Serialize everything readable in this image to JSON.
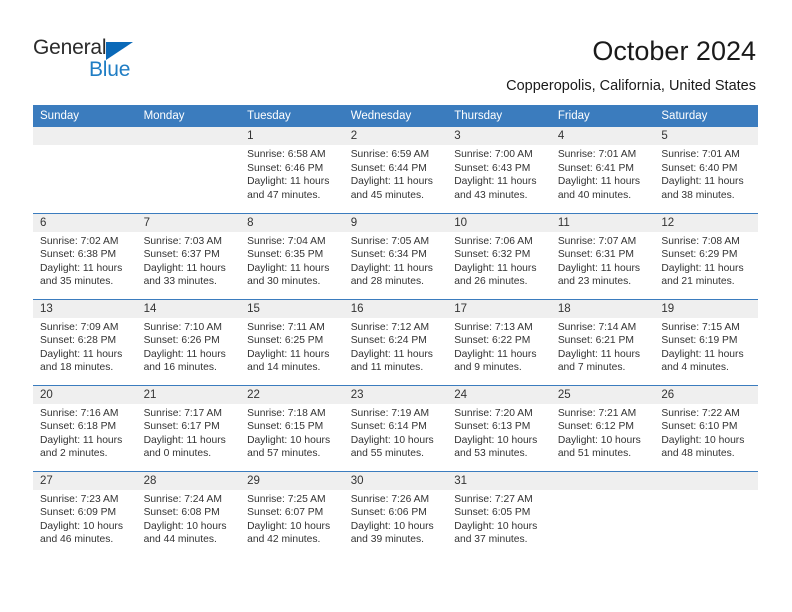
{
  "brand": {
    "name_top": "General",
    "name_bottom": "Blue",
    "triangle_color": "#0a69b8",
    "blue_text_color": "#1f7dc4"
  },
  "header": {
    "title": "October 2024",
    "location": "Copperopolis, California, United States",
    "header_bg": "#3b7cbe",
    "daynum_bg": "#efefef"
  },
  "weekday_headers": [
    "Sunday",
    "Monday",
    "Tuesday",
    "Wednesday",
    "Thursday",
    "Friday",
    "Saturday"
  ],
  "labels": {
    "sunrise": "Sunrise:",
    "sunset": "Sunset:",
    "daylight": "Daylight:"
  },
  "weeks": [
    [
      {
        "day": "",
        "sunrise": "",
        "sunset": "",
        "daylight_line1": "",
        "daylight_line2": ""
      },
      {
        "day": "",
        "sunrise": "",
        "sunset": "",
        "daylight_line1": "",
        "daylight_line2": ""
      },
      {
        "day": "1",
        "sunrise": "Sunrise: 6:58 AM",
        "sunset": "Sunset: 6:46 PM",
        "daylight_line1": "Daylight: 11 hours",
        "daylight_line2": "and 47 minutes."
      },
      {
        "day": "2",
        "sunrise": "Sunrise: 6:59 AM",
        "sunset": "Sunset: 6:44 PM",
        "daylight_line1": "Daylight: 11 hours",
        "daylight_line2": "and 45 minutes."
      },
      {
        "day": "3",
        "sunrise": "Sunrise: 7:00 AM",
        "sunset": "Sunset: 6:43 PM",
        "daylight_line1": "Daylight: 11 hours",
        "daylight_line2": "and 43 minutes."
      },
      {
        "day": "4",
        "sunrise": "Sunrise: 7:01 AM",
        "sunset": "Sunset: 6:41 PM",
        "daylight_line1": "Daylight: 11 hours",
        "daylight_line2": "and 40 minutes."
      },
      {
        "day": "5",
        "sunrise": "Sunrise: 7:01 AM",
        "sunset": "Sunset: 6:40 PM",
        "daylight_line1": "Daylight: 11 hours",
        "daylight_line2": "and 38 minutes."
      }
    ],
    [
      {
        "day": "6",
        "sunrise": "Sunrise: 7:02 AM",
        "sunset": "Sunset: 6:38 PM",
        "daylight_line1": "Daylight: 11 hours",
        "daylight_line2": "and 35 minutes."
      },
      {
        "day": "7",
        "sunrise": "Sunrise: 7:03 AM",
        "sunset": "Sunset: 6:37 PM",
        "daylight_line1": "Daylight: 11 hours",
        "daylight_line2": "and 33 minutes."
      },
      {
        "day": "8",
        "sunrise": "Sunrise: 7:04 AM",
        "sunset": "Sunset: 6:35 PM",
        "daylight_line1": "Daylight: 11 hours",
        "daylight_line2": "and 30 minutes."
      },
      {
        "day": "9",
        "sunrise": "Sunrise: 7:05 AM",
        "sunset": "Sunset: 6:34 PM",
        "daylight_line1": "Daylight: 11 hours",
        "daylight_line2": "and 28 minutes."
      },
      {
        "day": "10",
        "sunrise": "Sunrise: 7:06 AM",
        "sunset": "Sunset: 6:32 PM",
        "daylight_line1": "Daylight: 11 hours",
        "daylight_line2": "and 26 minutes."
      },
      {
        "day": "11",
        "sunrise": "Sunrise: 7:07 AM",
        "sunset": "Sunset: 6:31 PM",
        "daylight_line1": "Daylight: 11 hours",
        "daylight_line2": "and 23 minutes."
      },
      {
        "day": "12",
        "sunrise": "Sunrise: 7:08 AM",
        "sunset": "Sunset: 6:29 PM",
        "daylight_line1": "Daylight: 11 hours",
        "daylight_line2": "and 21 minutes."
      }
    ],
    [
      {
        "day": "13",
        "sunrise": "Sunrise: 7:09 AM",
        "sunset": "Sunset: 6:28 PM",
        "daylight_line1": "Daylight: 11 hours",
        "daylight_line2": "and 18 minutes."
      },
      {
        "day": "14",
        "sunrise": "Sunrise: 7:10 AM",
        "sunset": "Sunset: 6:26 PM",
        "daylight_line1": "Daylight: 11 hours",
        "daylight_line2": "and 16 minutes."
      },
      {
        "day": "15",
        "sunrise": "Sunrise: 7:11 AM",
        "sunset": "Sunset: 6:25 PM",
        "daylight_line1": "Daylight: 11 hours",
        "daylight_line2": "and 14 minutes."
      },
      {
        "day": "16",
        "sunrise": "Sunrise: 7:12 AM",
        "sunset": "Sunset: 6:24 PM",
        "daylight_line1": "Daylight: 11 hours",
        "daylight_line2": "and 11 minutes."
      },
      {
        "day": "17",
        "sunrise": "Sunrise: 7:13 AM",
        "sunset": "Sunset: 6:22 PM",
        "daylight_line1": "Daylight: 11 hours",
        "daylight_line2": "and 9 minutes."
      },
      {
        "day": "18",
        "sunrise": "Sunrise: 7:14 AM",
        "sunset": "Sunset: 6:21 PM",
        "daylight_line1": "Daylight: 11 hours",
        "daylight_line2": "and 7 minutes."
      },
      {
        "day": "19",
        "sunrise": "Sunrise: 7:15 AM",
        "sunset": "Sunset: 6:19 PM",
        "daylight_line1": "Daylight: 11 hours",
        "daylight_line2": "and 4 minutes."
      }
    ],
    [
      {
        "day": "20",
        "sunrise": "Sunrise: 7:16 AM",
        "sunset": "Sunset: 6:18 PM",
        "daylight_line1": "Daylight: 11 hours",
        "daylight_line2": "and 2 minutes."
      },
      {
        "day": "21",
        "sunrise": "Sunrise: 7:17 AM",
        "sunset": "Sunset: 6:17 PM",
        "daylight_line1": "Daylight: 11 hours",
        "daylight_line2": "and 0 minutes."
      },
      {
        "day": "22",
        "sunrise": "Sunrise: 7:18 AM",
        "sunset": "Sunset: 6:15 PM",
        "daylight_line1": "Daylight: 10 hours",
        "daylight_line2": "and 57 minutes."
      },
      {
        "day": "23",
        "sunrise": "Sunrise: 7:19 AM",
        "sunset": "Sunset: 6:14 PM",
        "daylight_line1": "Daylight: 10 hours",
        "daylight_line2": "and 55 minutes."
      },
      {
        "day": "24",
        "sunrise": "Sunrise: 7:20 AM",
        "sunset": "Sunset: 6:13 PM",
        "daylight_line1": "Daylight: 10 hours",
        "daylight_line2": "and 53 minutes."
      },
      {
        "day": "25",
        "sunrise": "Sunrise: 7:21 AM",
        "sunset": "Sunset: 6:12 PM",
        "daylight_line1": "Daylight: 10 hours",
        "daylight_line2": "and 51 minutes."
      },
      {
        "day": "26",
        "sunrise": "Sunrise: 7:22 AM",
        "sunset": "Sunset: 6:10 PM",
        "daylight_line1": "Daylight: 10 hours",
        "daylight_line2": "and 48 minutes."
      }
    ],
    [
      {
        "day": "27",
        "sunrise": "Sunrise: 7:23 AM",
        "sunset": "Sunset: 6:09 PM",
        "daylight_line1": "Daylight: 10 hours",
        "daylight_line2": "and 46 minutes."
      },
      {
        "day": "28",
        "sunrise": "Sunrise: 7:24 AM",
        "sunset": "Sunset: 6:08 PM",
        "daylight_line1": "Daylight: 10 hours",
        "daylight_line2": "and 44 minutes."
      },
      {
        "day": "29",
        "sunrise": "Sunrise: 7:25 AM",
        "sunset": "Sunset: 6:07 PM",
        "daylight_line1": "Daylight: 10 hours",
        "daylight_line2": "and 42 minutes."
      },
      {
        "day": "30",
        "sunrise": "Sunrise: 7:26 AM",
        "sunset": "Sunset: 6:06 PM",
        "daylight_line1": "Daylight: 10 hours",
        "daylight_line2": "and 39 minutes."
      },
      {
        "day": "31",
        "sunrise": "Sunrise: 7:27 AM",
        "sunset": "Sunset: 6:05 PM",
        "daylight_line1": "Daylight: 10 hours",
        "daylight_line2": "and 37 minutes."
      },
      {
        "day": "",
        "sunrise": "",
        "sunset": "",
        "daylight_line1": "",
        "daylight_line2": ""
      },
      {
        "day": "",
        "sunrise": "",
        "sunset": "",
        "daylight_line1": "",
        "daylight_line2": ""
      }
    ]
  ]
}
